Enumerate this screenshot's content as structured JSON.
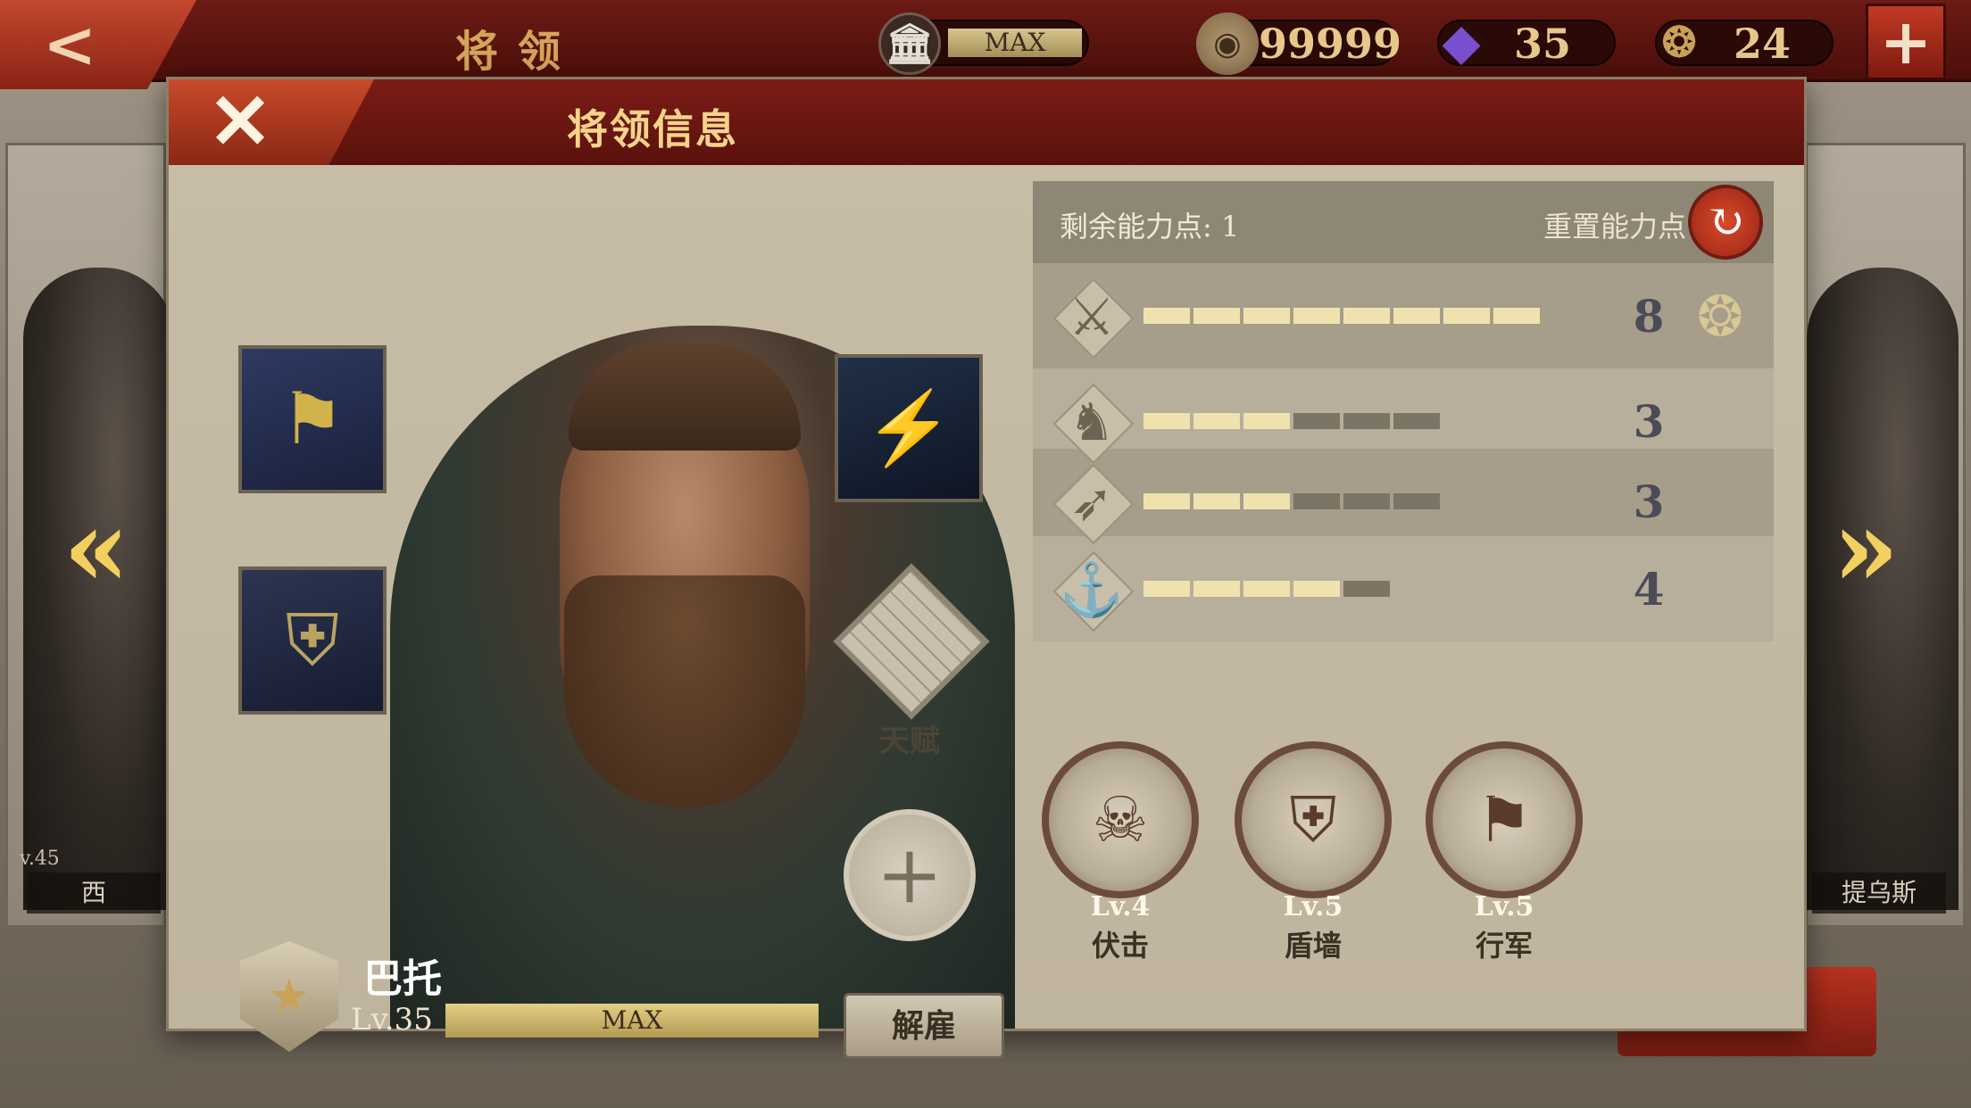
{
  "topbar": {
    "back_icon": "chevron-left-icon",
    "title": "将领",
    "treasury": {
      "icon": "temple-icon",
      "value": "MAX"
    },
    "gold": {
      "icon": "coin-icon",
      "value": "99999"
    },
    "gems": {
      "icon": "gem-icon",
      "value": "35"
    },
    "laurel": {
      "icon": "laurel-emblem-icon",
      "value": "24"
    },
    "add_icon": "plus-icon"
  },
  "background": {
    "left_general_name": "西",
    "left_general_level": "v.45",
    "right_general_name": "提乌斯"
  },
  "dialog": {
    "title": "将领信息",
    "close_icon": "close-icon"
  },
  "general": {
    "name": "巴托",
    "level": "Lv.35",
    "exp_label": "MAX",
    "dismiss_label": "解雇",
    "talent_label": "天赋"
  },
  "equipment": [
    {
      "slot": "banner",
      "icon": "spqr-banner-icon"
    },
    {
      "slot": "armor",
      "icon": "armor-icon"
    },
    {
      "slot": "shield",
      "icon": "shield-icon"
    }
  ],
  "attributes": {
    "remaining_label": "剩余能力点: 1",
    "reset_label": "重置能力点",
    "rows": [
      {
        "icon": "sword-icon",
        "value": "8",
        "filled": 8,
        "total": 8,
        "medal": true
      },
      {
        "icon": "horse-icon",
        "value": "3",
        "filled": 3,
        "total": 6,
        "medal": false
      },
      {
        "icon": "bow-icon",
        "value": "3",
        "filled": 3,
        "total": 6,
        "medal": false
      },
      {
        "icon": "anchor-icon",
        "value": "4",
        "filled": 4,
        "total": 5,
        "medal": false
      }
    ]
  },
  "skills": [
    {
      "level": "Lv.4",
      "name": "伏击",
      "icon": "ambush-icon"
    },
    {
      "level": "Lv.5",
      "name": "盾墙",
      "icon": "shield-wall-icon"
    },
    {
      "level": "Lv.5",
      "name": "行军",
      "icon": "march-icon"
    }
  ],
  "colors": {
    "accent_red": "#7c1c16",
    "bar_fill": "#efe2ae",
    "bar_empty": "#7c7465",
    "gold_text": "#f4d38a"
  }
}
